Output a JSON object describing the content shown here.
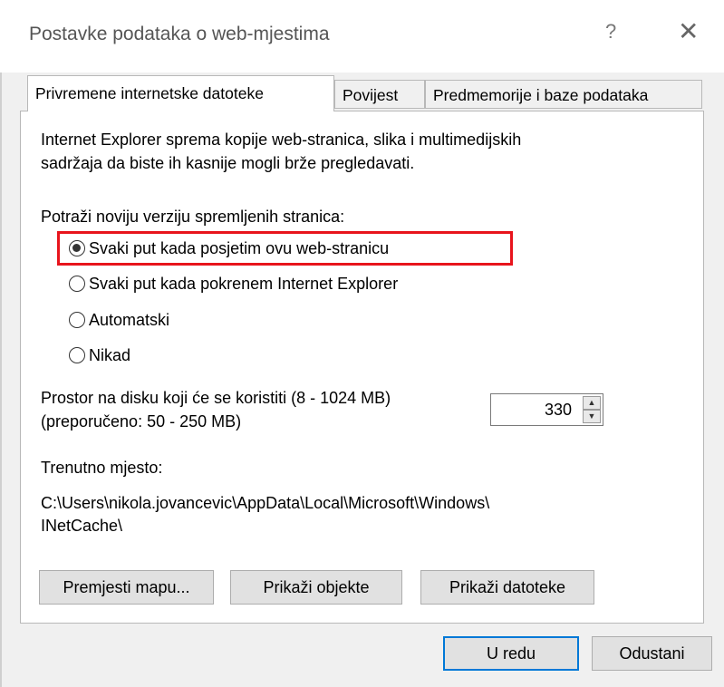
{
  "window": {
    "title": "Postavke podataka o web-mjestima",
    "help_glyph": "?",
    "close_glyph": "✕"
  },
  "tabs": [
    {
      "label": "Privremene internetske datoteke",
      "active": true
    },
    {
      "label": "Povijest",
      "active": false
    },
    {
      "label": "Predmemorije i baze podataka",
      "active": false
    }
  ],
  "temp_files": {
    "description_line1": "Internet Explorer sprema kopije web-stranica, slika i multimedijskih",
    "description_line2": "sadržaja da biste ih kasnije mogli brže pregledavati.",
    "check_heading": "Potraži noviju verziju spremljenih stranica:",
    "options": [
      {
        "label": "Svaki put kada posjetim ovu web-stranicu",
        "selected": true
      },
      {
        "label": "Svaki put kada pokrenem Internet Explorer",
        "selected": false
      },
      {
        "label": "Automatski",
        "selected": false
      },
      {
        "label": "Nikad",
        "selected": false
      }
    ],
    "disk_space_line1": "Prostor na disku koji će se koristiti (8 - 1024 MB)",
    "disk_space_line2": "(preporučeno: 50 - 250 MB)",
    "disk_space_value": "330",
    "current_location_label": "Trenutno mjesto:",
    "current_location_line1": "C:\\Users\\nikola.jovancevic\\AppData\\Local\\Microsoft\\Windows\\",
    "current_location_line2": "INetCache\\",
    "buttons": {
      "move_folder": "Premjesti mapu...",
      "view_objects": "Prikaži objekte",
      "view_files": "Prikaži datoteke"
    }
  },
  "footer": {
    "ok": "U redu",
    "cancel": "Odustani"
  },
  "colors": {
    "highlight_border": "#e8141c",
    "ok_border": "#0078d7"
  }
}
